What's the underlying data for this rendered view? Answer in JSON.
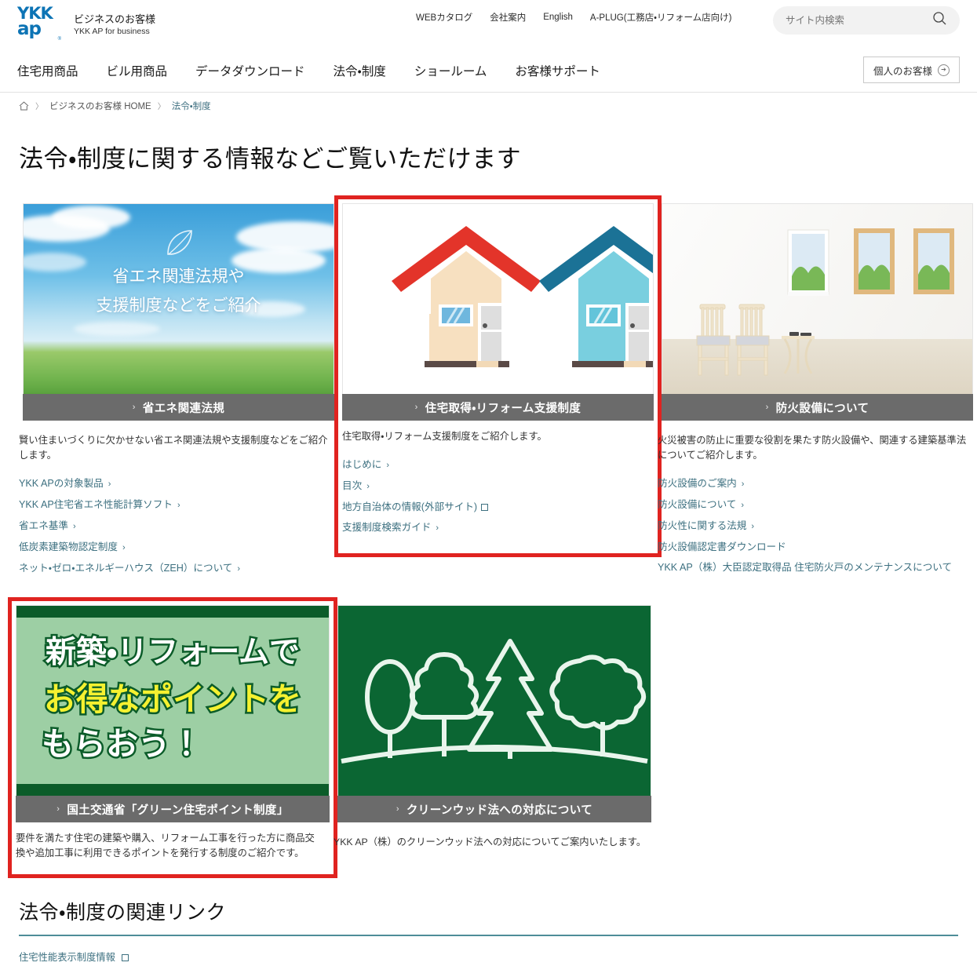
{
  "header": {
    "logo": {
      "line1": "YKK",
      "line2": "ap",
      "reg": "®"
    },
    "brand_jp": "ビジネスのお客様",
    "brand_en": "YKK AP for business",
    "utility_links": [
      {
        "label": "WEBカタログ"
      },
      {
        "label": "会社案内"
      },
      {
        "label": "English"
      },
      {
        "label": "A-PLUG(工務店・リフォーム店向け)"
      }
    ],
    "search": {
      "placeholder": "サイト内検索",
      "icon": "search-icon"
    },
    "persona_button": {
      "label": "個人のお客様",
      "icon": "circle-arrow-right-icon"
    }
  },
  "mainnav": {
    "items": [
      {
        "label": "住宅用商品"
      },
      {
        "label": "ビル用商品"
      },
      {
        "label": "データダウンロード"
      },
      {
        "label": "法令・制度"
      },
      {
        "label": "ショールーム"
      },
      {
        "label": "お客様サポート"
      }
    ]
  },
  "breadcrumb": {
    "home_icon": "home-icon",
    "items": [
      {
        "label": "ビジネスのお客様 HOME",
        "current": false
      },
      {
        "label": "法令・制度",
        "current": true
      }
    ],
    "separator": "〉"
  },
  "page": {
    "title": "法令・制度に関する情報などご覧いただけます"
  },
  "cards": [
    {
      "id": "energy-saving",
      "flagged": false,
      "thumb_text_line1": "省エネ関連法規や",
      "thumb_text_line2": "支援制度などをご紹介",
      "bar_label": "省エネ関連法規",
      "bar_chevron": "›",
      "description": "賢い住まいづくりに欠かせない省エネ関連法規や支援制度などをご紹介します。",
      "links": [
        {
          "label": "YKK APの対象製品",
          "external": false
        },
        {
          "label": "YKK AP住宅省エネ性能計算ソフト",
          "external": false
        },
        {
          "label": "省エネ基準",
          "external": false
        },
        {
          "label": "低炭素建築物認定制度",
          "external": false
        },
        {
          "label": "ネット・ゼロ・エネルギーハウス（ZEH）について",
          "external": false
        }
      ]
    },
    {
      "id": "housing-support",
      "flagged": true,
      "bar_label": "住宅取得・リフォーム支援制度",
      "bar_chevron": "›",
      "description": "住宅取得・リフォーム支援制度をご紹介します。",
      "links": [
        {
          "label": "はじめに",
          "external": false
        },
        {
          "label": "目次",
          "external": false
        },
        {
          "label": "地方自治体の情報(外部サイト)",
          "external": true
        },
        {
          "label": "支援制度検索ガイド",
          "external": false
        }
      ]
    },
    {
      "id": "fire-prevention",
      "flagged": false,
      "bar_label": "防火設備について",
      "bar_chevron": "›",
      "description": "火災被害の防止に重要な役割を果たす防火設備や、関連する建築基準法についてご紹介します。",
      "links": [
        {
          "label": "防火設備のご案内",
          "external": false
        },
        {
          "label": "防火設備について",
          "external": false
        },
        {
          "label": "防火性に関する法規",
          "external": false
        },
        {
          "label": "防火設備認定書ダウンロード",
          "external": false,
          "plain": true
        },
        {
          "label": "YKK AP（株）大臣認定取得品 住宅防火戸のメンテナンスについて",
          "external": false,
          "plain": true
        }
      ]
    },
    {
      "id": "green-housing-points",
      "flagged": true,
      "banner_line1": "新築・リフォームで",
      "banner_line2": "お得なポイントを",
      "banner_line3": "もらおう！",
      "bar_label": "国土交通省「グリーン住宅ポイント制度」",
      "bar_chevron": "›",
      "description": "要件を満たす住宅の建築や購入、リフォーム工事を行った方に商品交換や追加工事に利用できるポイントを発行する制度のご紹介です。",
      "links": []
    },
    {
      "id": "clean-wood-act",
      "flagged": false,
      "bar_label": "クリーンウッド法への対応について",
      "bar_chevron": "›",
      "description": "YKK AP（株）のクリーンウッド法への対応についてご案内いたします。",
      "links": []
    }
  ],
  "related": {
    "title": "法令・制度の関連リンク",
    "links": [
      {
        "label": "住宅性能表示制度情報",
        "external": true
      }
    ]
  },
  "colors": {
    "brand_blue": "#0d74b5",
    "flag_red": "#e02320",
    "card_bar_gray": "#6b6b6b",
    "link_teal": "#3d7080",
    "rule_teal": "#4e8d98",
    "green_dark": "#0b6633"
  }
}
